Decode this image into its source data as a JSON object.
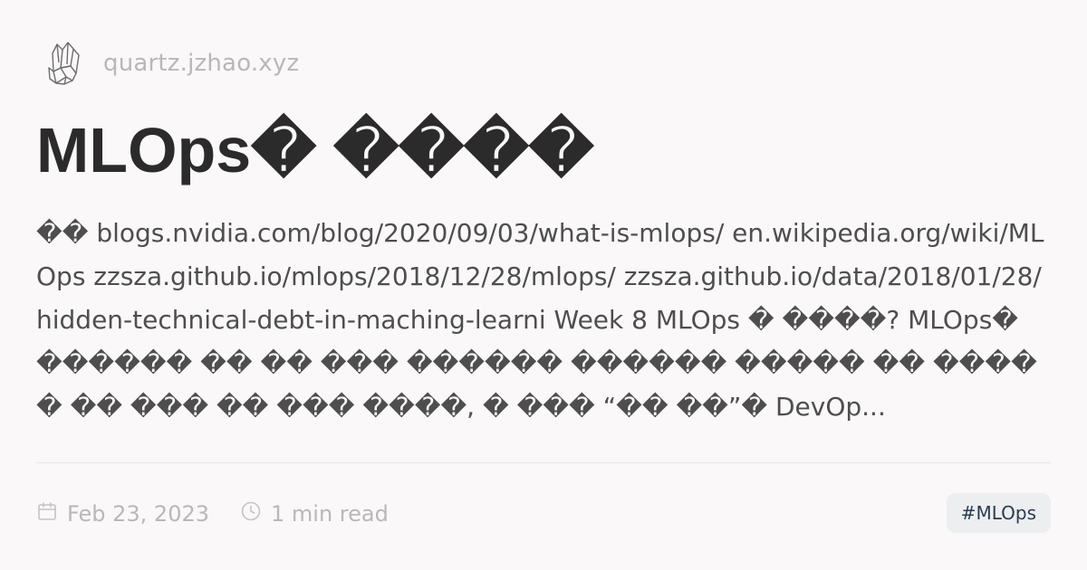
{
  "site": {
    "logo_icon": "crystal-cluster-icon",
    "name": "quartz.jzhao.xyz"
  },
  "article": {
    "title": "MLOps� ����",
    "description": "�� blogs.nvidia.com/blog/2020/09/03/what-is-mlops/ en.wikipedia.org/wiki/MLOps zzsza.github.io/mlops/2018/12/28/mlops/ zzsza.github.io/data/2018/01/28/hidden-technical-debt-in-maching-learni Week 8 MLOps � ����? MLOps� ������ �� �� ��� ������ ������ ����� �� ����� �� ��� �� ��� ����, � ��� “�� ��”� DevOp...",
    "date": "Feb 23, 2023",
    "read_time": "1 min read",
    "tag": "#MLOps"
  },
  "icons": {
    "date": "calendar-icon",
    "read_time": "clock-icon"
  },
  "colors": {
    "background": "#faf8f8",
    "title": "#2b2b2b",
    "body": "#4e4e4e",
    "muted": "#b8b8b8",
    "tag_bg": "#eceef0",
    "tag_text": "#2a3c52"
  }
}
